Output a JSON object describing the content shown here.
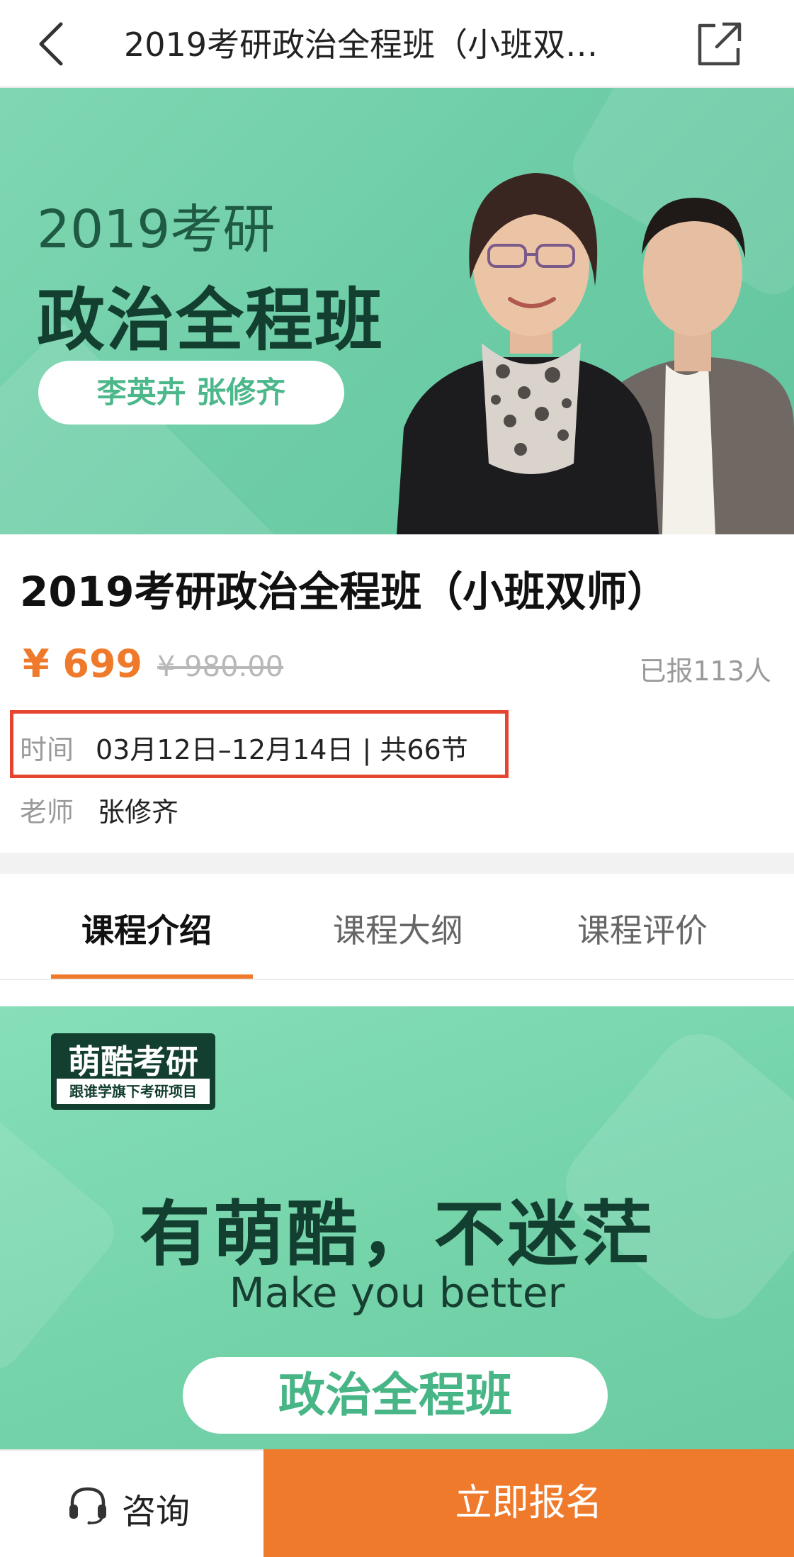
{
  "nav": {
    "title": "2019考研政治全程班（小班双…",
    "back_icon": "chevron-left-icon",
    "share_icon": "share-icon"
  },
  "hero": {
    "subtitle": "2019考研",
    "title": "政治全程班",
    "teachers": "李英卉 张修齐"
  },
  "course": {
    "title": "2019考研政治全程班（小班双师）",
    "price": "¥ 699",
    "original_price": "¥ 980.00",
    "enrolled": "已报113人",
    "time_label": "时间",
    "time_value": "03月12日–12月14日 | 共66节",
    "teacher_label": "老师",
    "teacher_value": "张修齐"
  },
  "tabs": [
    {
      "label": "课程介绍",
      "active": true
    },
    {
      "label": "课程大纲",
      "active": false
    },
    {
      "label": "课程评价",
      "active": false
    }
  ],
  "banner2": {
    "logo_text": "萌酷考研",
    "logo_sub": "跟谁学旗下考研项目",
    "slogan": "有萌酷，不迷茫",
    "slogan_en": "Make you better",
    "pill": "政治全程班"
  },
  "bottom": {
    "consult_label": "咨询",
    "consult_icon": "headset-icon",
    "enroll_label": "立即报名"
  },
  "colors": {
    "accent": "#f07a2c",
    "highlight_box": "#e5452e",
    "hero_green": "#6fcea8",
    "dark_green": "#133f30"
  }
}
